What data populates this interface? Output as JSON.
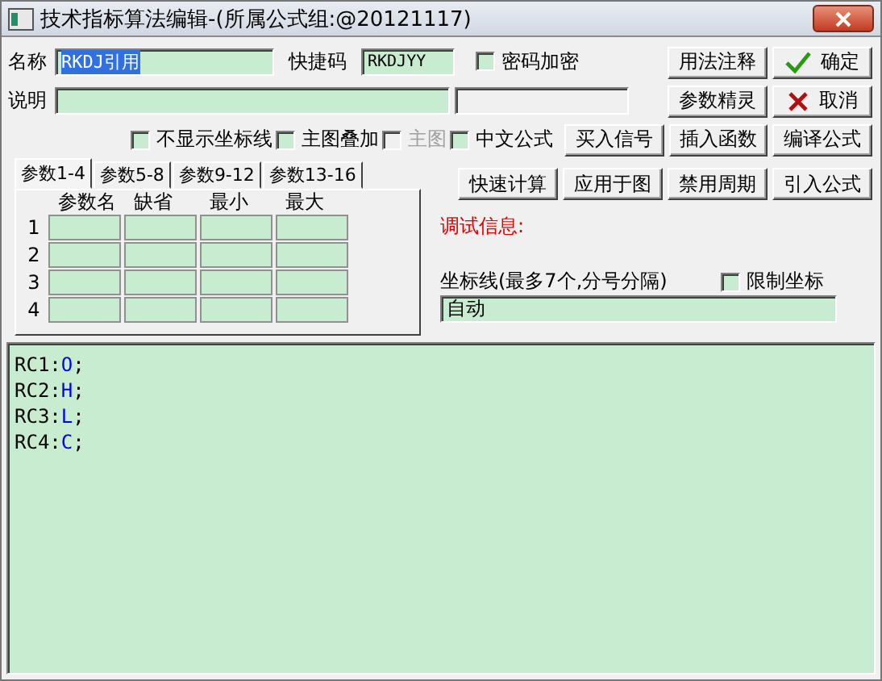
{
  "window": {
    "title": "技术指标算法编辑-(所属公式组:@20121117)"
  },
  "name": {
    "label": "名称",
    "value": "RKDJ引用",
    "selected": true
  },
  "shortcut": {
    "label": "快捷码",
    "value": "RKDJYY"
  },
  "password": {
    "label": "密码加密",
    "checked": false
  },
  "description": {
    "label": "说明"
  },
  "options": [
    {
      "label": "不显示坐标线",
      "checked": false,
      "disabled": false
    },
    {
      "label": "主图叠加",
      "checked": false,
      "disabled": false
    },
    {
      "label": "主图",
      "checked": false,
      "disabled": true
    },
    {
      "label": "中文公式",
      "checked": false,
      "disabled": false
    }
  ],
  "row1_buttons": [
    {
      "label": "用法注释",
      "kind": "plain"
    },
    {
      "label": "确定",
      "kind": "ok"
    }
  ],
  "row2_buttons": [
    {
      "label": "参数精灵",
      "kind": "plain"
    },
    {
      "label": "取消",
      "kind": "cancel"
    }
  ],
  "row3_buttons": [
    {
      "label": "买入信号"
    },
    {
      "label": "插入函数"
    },
    {
      "label": "编译公式"
    }
  ],
  "row4_buttons": [
    {
      "label": "快速计算"
    },
    {
      "label": "应用于图"
    },
    {
      "label": "禁用周期"
    },
    {
      "label": "引入公式"
    }
  ],
  "tabs": [
    {
      "label": "参数1-4",
      "selected": true
    },
    {
      "label": "参数5-8",
      "selected": false
    },
    {
      "label": "参数9-12",
      "selected": false
    },
    {
      "label": "参数13-16",
      "selected": false
    }
  ],
  "param_table": {
    "columns": [
      "参数名",
      "缺省",
      "最小",
      "最大"
    ],
    "rows": [
      "1",
      "2",
      "3",
      "4"
    ]
  },
  "debug": {
    "label": "调试信息:"
  },
  "axis": {
    "label": "坐标线(最多7个,分号分隔)",
    "limit": {
      "label": "限制坐标",
      "checked": false
    },
    "value": "自动"
  },
  "code": [
    {
      "name": "RC1:",
      "value": "O",
      "end": ";"
    },
    {
      "name": "RC2:",
      "value": "H",
      "end": ";"
    },
    {
      "name": "RC3:",
      "value": "L",
      "end": ";"
    },
    {
      "name": "RC4:",
      "value": "C",
      "end": ";"
    }
  ]
}
